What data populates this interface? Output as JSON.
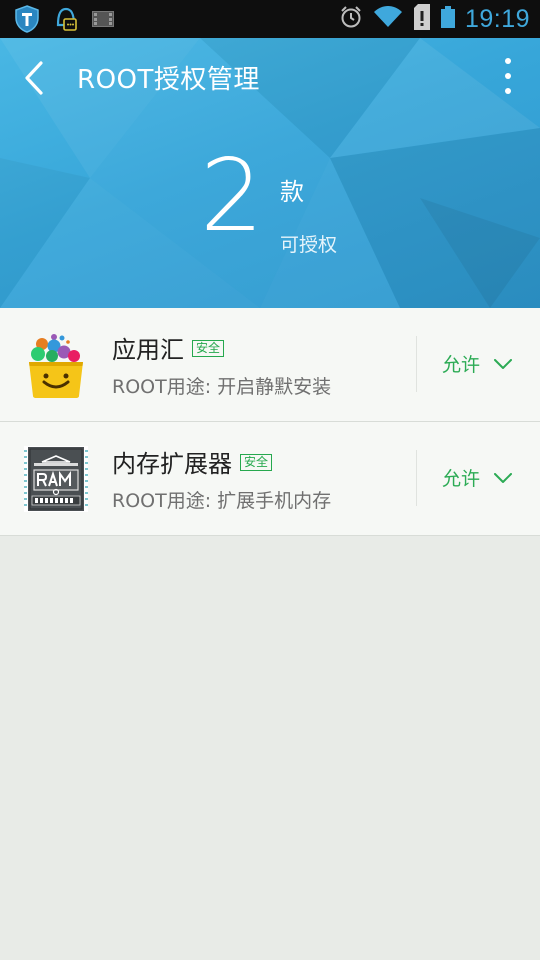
{
  "status_bar": {
    "time": "19:19",
    "left_icons": [
      "shield-app-icon",
      "notification-bell-icon",
      "film-icon"
    ],
    "right_icons": [
      "alarm-icon",
      "wifi-icon",
      "sim-alert-icon",
      "battery-icon"
    ]
  },
  "header": {
    "title": "ROOT授权管理",
    "count": "2",
    "count_unit": "款",
    "count_sub": "可授权",
    "accent_color": "#37a6d9"
  },
  "apps": [
    {
      "name": "应用汇",
      "badge": "安全",
      "desc": "ROOT用途: 开启静默安装",
      "permission": "允许",
      "icon": "app-store-bag-icon"
    },
    {
      "name": "内存扩展器",
      "badge": "安全",
      "desc": "ROOT用途: 扩展手机内存",
      "permission": "允许",
      "icon": "ram-chip-icon"
    }
  ]
}
